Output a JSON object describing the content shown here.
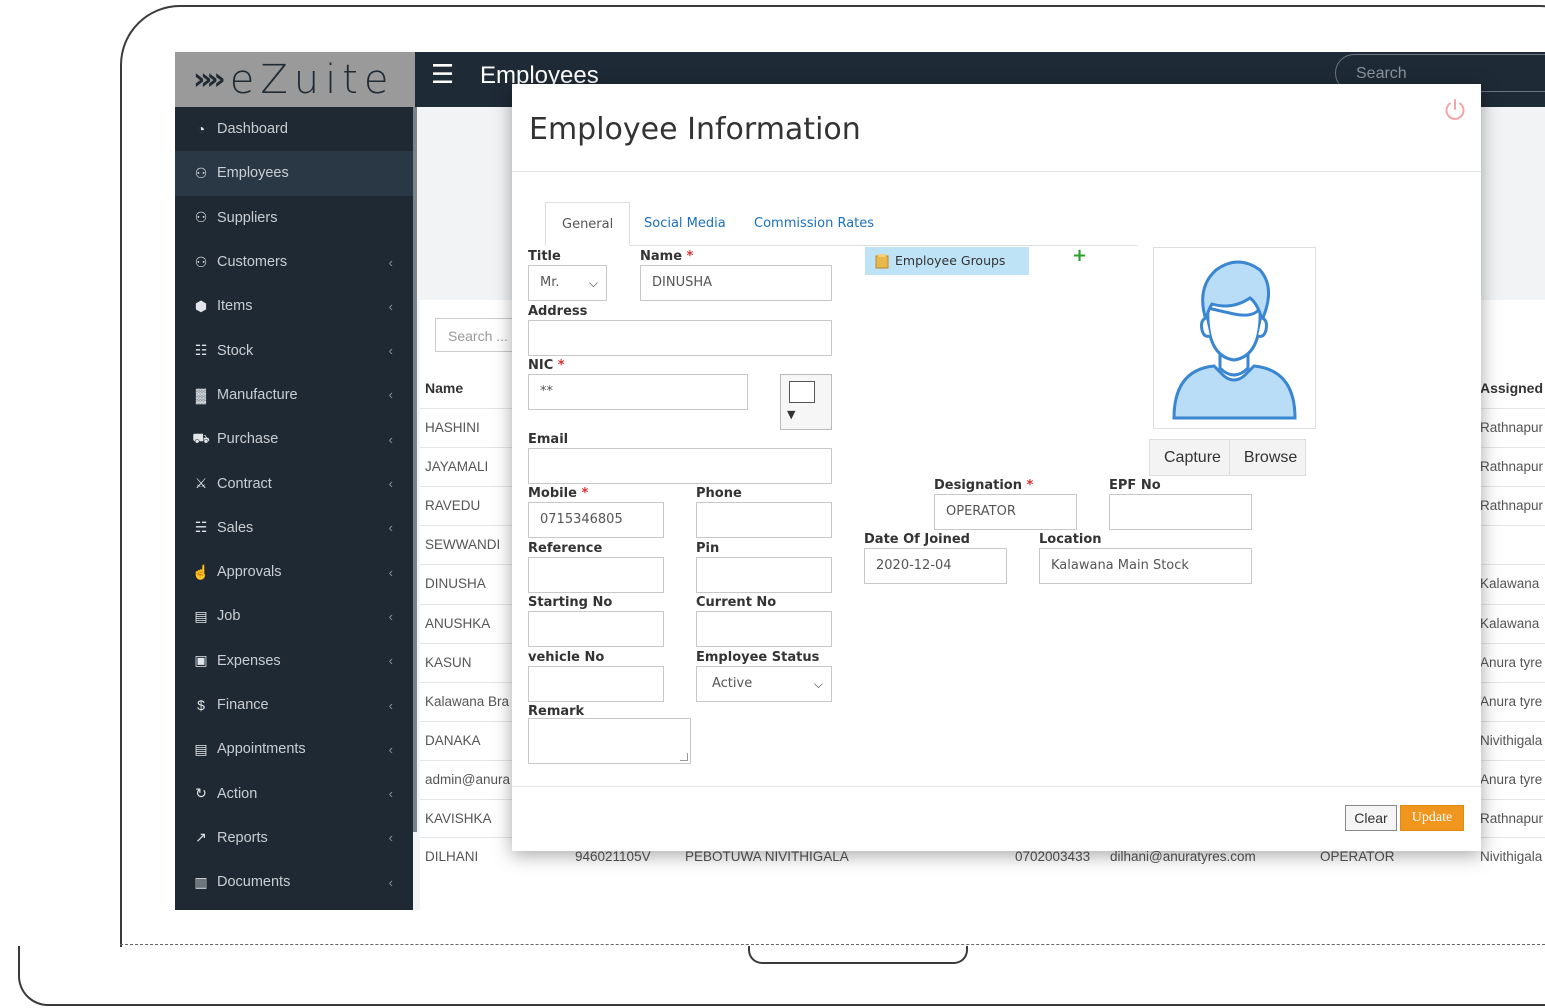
{
  "app": {
    "logo_text": "eZuite",
    "page_title": "Employees",
    "search_placeholder": "Search"
  },
  "sidebar": {
    "items": [
      {
        "label": "Dashboard",
        "icon": "dashboard-icon",
        "chevron": false,
        "active": false
      },
      {
        "label": "Employees",
        "icon": "users-icon",
        "chevron": false,
        "active": true
      },
      {
        "label": "Suppliers",
        "icon": "users-icon",
        "chevron": false,
        "active": false
      },
      {
        "label": "Customers",
        "icon": "users-icon",
        "chevron": true,
        "active": false
      },
      {
        "label": "Items",
        "icon": "cube-icon",
        "chevron": true,
        "active": false
      },
      {
        "label": "Stock",
        "icon": "cubes-icon",
        "chevron": true,
        "active": false
      },
      {
        "label": "Manufacture",
        "icon": "industry-icon",
        "chevron": true,
        "active": false
      },
      {
        "label": "Purchase",
        "icon": "truck-icon",
        "chevron": true,
        "active": false
      },
      {
        "label": "Contract",
        "icon": "handshake-icon",
        "chevron": true,
        "active": false
      },
      {
        "label": "Sales",
        "icon": "cart-icon",
        "chevron": true,
        "active": false
      },
      {
        "label": "Approvals",
        "icon": "thumbs-up-icon",
        "chevron": true,
        "active": false
      },
      {
        "label": "Job",
        "icon": "briefcase-icon",
        "chevron": true,
        "active": false
      },
      {
        "label": "Expenses",
        "icon": "money-icon",
        "chevron": true,
        "active": false
      },
      {
        "label": "Finance",
        "icon": "dollar-icon",
        "chevron": true,
        "active": false
      },
      {
        "label": "Appointments",
        "icon": "briefcase-icon",
        "chevron": true,
        "active": false
      },
      {
        "label": "Action",
        "icon": "refresh-icon",
        "chevron": true,
        "active": false
      },
      {
        "label": "Reports",
        "icon": "chart-icon",
        "chevron": true,
        "active": false
      },
      {
        "label": "Documents",
        "icon": "file-icon",
        "chevron": true,
        "active": false
      }
    ]
  },
  "background_table": {
    "search_placeholder": "Search ...",
    "headers": {
      "name": "Name",
      "assigned": "Assigned"
    },
    "rows": [
      {
        "name": "HASHINI",
        "assigned": "Rathnapur"
      },
      {
        "name": "JAYAMALI",
        "assigned": "Rathnapur"
      },
      {
        "name": "RAVEDU",
        "assigned": "Rathnapur"
      },
      {
        "name": "SEWWANDI",
        "assigned": ""
      },
      {
        "name": "DINUSHA",
        "assigned": "Kalawana"
      },
      {
        "name": "ANUSHKA",
        "assigned": "Kalawana"
      },
      {
        "name": "KASUN",
        "assigned": "Anura tyre"
      },
      {
        "name": "Kalawana Bra",
        "assigned": "Anura tyre"
      },
      {
        "name": "DANAKA",
        "assigned": "Nivithigala"
      },
      {
        "name": "admin@anura",
        "assigned": "Anura tyre"
      },
      {
        "name": "KAVISHKA",
        "assigned": "Rathnapur"
      }
    ],
    "last_row": {
      "name": "DILHANI",
      "nic": "946021105V",
      "address": "PEBOTUWA NIVITHIGALA",
      "mobile": "0702003433",
      "email": "dilhani@anuratyres.com",
      "designation": "OPERATOR",
      "assigned": "Nivithigala"
    }
  },
  "modal": {
    "title": "Employee Information",
    "tabs": [
      "General",
      "Social Media",
      "Commission Rates"
    ],
    "labels": {
      "title": "Title",
      "name": "Name",
      "address": "Address",
      "nic": "NIC",
      "email": "Email",
      "mobile": "Mobile",
      "phone": "Phone",
      "reference": "Reference",
      "pin": "Pin",
      "starting_no": "Starting No",
      "current_no": "Current No",
      "vehicle_no": "vehicle No",
      "employee_status": "Employee Status",
      "remark": "Remark",
      "designation": "Designation",
      "epf_no": "EPF No",
      "date_of_joined": "Date Of Joined",
      "location": "Location",
      "required_mark": "*"
    },
    "values": {
      "title": "Mr.",
      "name": "DINUSHA",
      "address": "",
      "nic": "**",
      "email": "",
      "mobile": "0715346805",
      "phone": "",
      "reference": "",
      "pin": "",
      "starting_no": "",
      "current_no": "",
      "vehicle_no": "",
      "employee_status": "Active",
      "remark": "",
      "designation": "OPERATOR",
      "epf_no": "",
      "date_of_joined": "2020-12-04",
      "location": "Kalawana Main Stock"
    },
    "employee_groups_label": "Employee Groups",
    "add_group_symbol": "+",
    "nic_dropdown_arrow": "▼",
    "capture_label": "Capture",
    "browse_label": "Browse",
    "clear_label": "Clear",
    "update_label": "Update"
  },
  "colors": {
    "sidebar_bg": "#1f2933",
    "topbar_bg": "#1e2a36",
    "link_blue": "#1a6fbf",
    "required_red": "#d9302c",
    "update_orange": "#f0961f",
    "groups_bg": "#bfe3f6",
    "avatar_blue": "#3a86d0"
  }
}
